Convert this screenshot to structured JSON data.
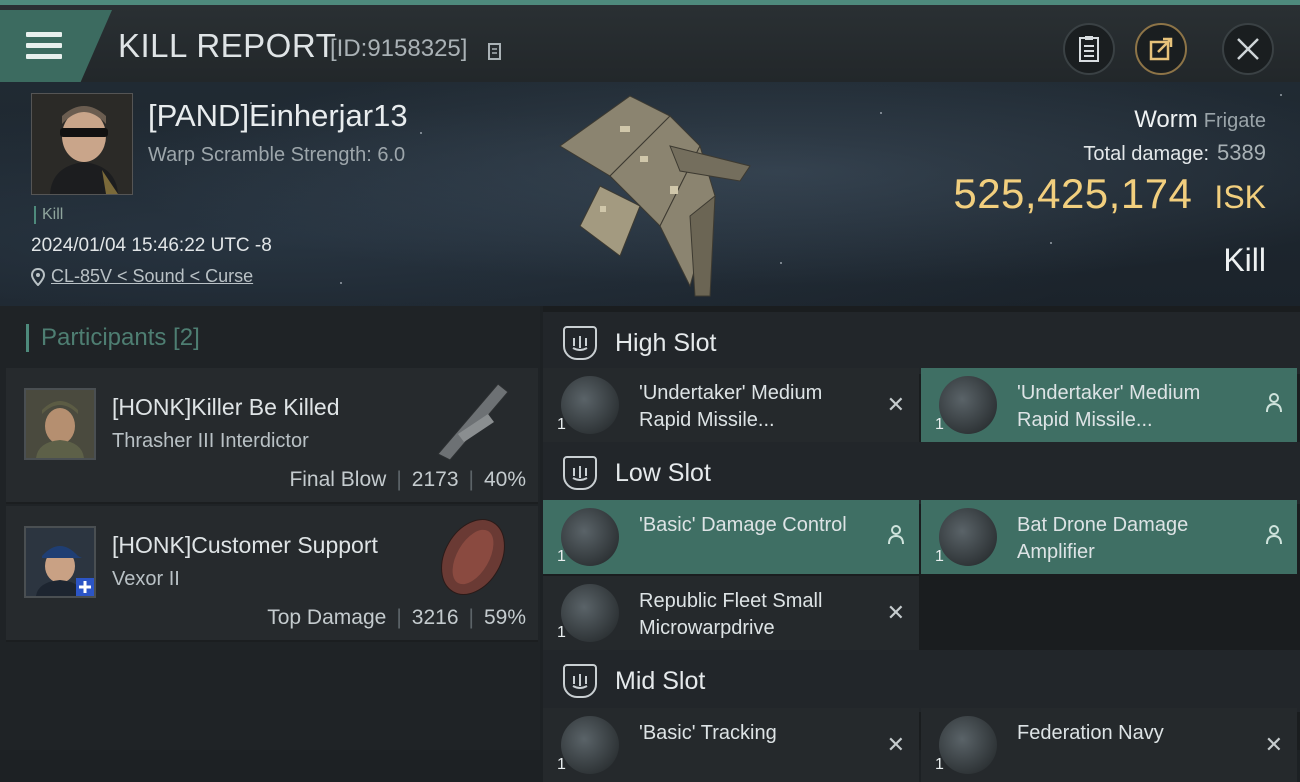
{
  "header": {
    "title": "KILL REPORT",
    "report_id": "[ID:9158325]"
  },
  "victim": {
    "name": "[PAND]Einherjar13",
    "warp_scramble": "Warp Scramble Strength: 6.0",
    "tag": "Kill",
    "datetime": "2024/01/04 15:46:22 UTC -8",
    "location": "CL-85V < Sound < Curse",
    "ship_name": "Worm",
    "ship_class": "Frigate",
    "total_damage_label": "Total damage:",
    "total_damage_value": "5389",
    "isk_value": "525,425,174",
    "isk_unit": "ISK",
    "result": "Kill"
  },
  "participants": {
    "header": "Participants [2]",
    "items": [
      {
        "name": "[HONK]Killer Be Killed",
        "ship": "Thrasher III Interdictor",
        "role": "Final Blow",
        "damage": "2173",
        "percent": "40%"
      },
      {
        "name": "[HONK]Customer Support",
        "ship": "Vexor II",
        "role": "Top Damage",
        "damage": "3216",
        "percent": "59%"
      }
    ]
  },
  "slots": {
    "high": {
      "title": "High Slot",
      "modules": [
        {
          "name": "'Undertaker' Medium Rapid Missile...",
          "qty": "1",
          "status": "destroyed"
        },
        {
          "name": "'Undertaker' Medium Rapid Missile...",
          "qty": "1",
          "status": "dropped"
        }
      ]
    },
    "low": {
      "title": "Low Slot",
      "modules": [
        {
          "name": "'Basic' Damage Control",
          "qty": "1",
          "status": "dropped"
        },
        {
          "name": "Bat Drone Damage Amplifier",
          "qty": "1",
          "status": "dropped"
        },
        {
          "name": "Republic Fleet Small Microwarpdrive",
          "qty": "1",
          "status": "destroyed"
        }
      ]
    },
    "mid": {
      "title": "Mid Slot",
      "modules": [
        {
          "name": "'Basic' Tracking",
          "qty": "1",
          "status": "destroyed"
        },
        {
          "name": "Federation Navy",
          "qty": "1",
          "status": "destroyed"
        }
      ]
    }
  },
  "colors": {
    "accent": "#4e8a7c",
    "isk": "#f2cf7e",
    "fitted": "#3f6f64"
  }
}
